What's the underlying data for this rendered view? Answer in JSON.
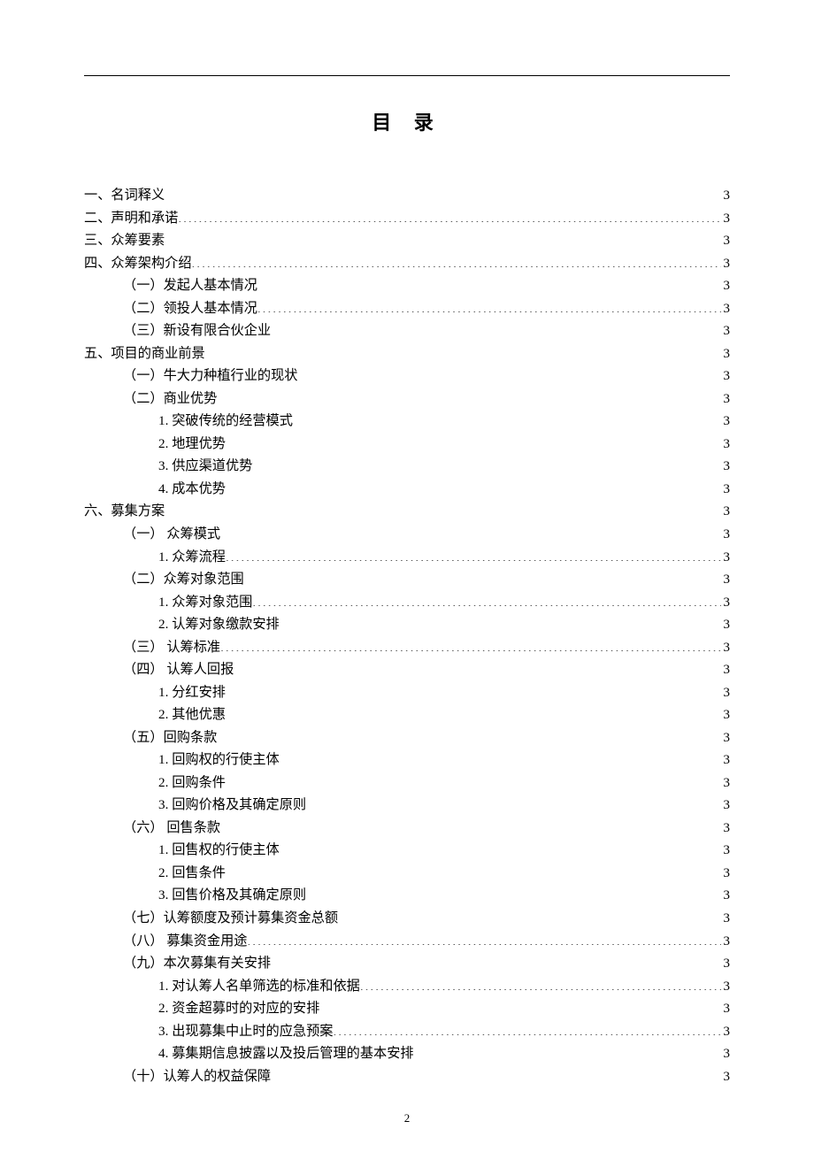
{
  "title": "目 录",
  "page_number": "2",
  "toc": [
    {
      "level": 1,
      "text": "一、名词释义",
      "page": "3"
    },
    {
      "level": 1,
      "text": "二、声明和承诺",
      "page": "3"
    },
    {
      "level": 1,
      "text": "三、众筹要素",
      "page": "3"
    },
    {
      "level": 1,
      "text": "四、众筹架构介绍",
      "page": "3"
    },
    {
      "level": 2,
      "text": "（一）发起人基本情况",
      "page": "3"
    },
    {
      "level": 2,
      "text": "（二）领投人基本情况",
      "page": "3"
    },
    {
      "level": 2,
      "text": "（三）新设有限合伙企业",
      "page": "3"
    },
    {
      "level": 1,
      "text": "五、项目的商业前景",
      "page": "3"
    },
    {
      "level": 2,
      "text": "（一）牛大力种植行业的现状",
      "page": "3"
    },
    {
      "level": 2,
      "text": "（二）商业优势",
      "page": "3"
    },
    {
      "level": 3,
      "text": "1. 突破传统的经营模式",
      "page": "3"
    },
    {
      "level": 3,
      "text": "2. 地理优势",
      "page": "3"
    },
    {
      "level": 3,
      "text": "3. 供应渠道优势",
      "page": "3"
    },
    {
      "level": 3,
      "text": "4. 成本优势",
      "page": "3"
    },
    {
      "level": 1,
      "text": "六、募集方案",
      "page": "3"
    },
    {
      "level": 2,
      "text": "（一） 众筹模式",
      "page": "3"
    },
    {
      "level": 3,
      "text": "1.  众筹流程",
      "page": "3"
    },
    {
      "level": 2,
      "text": "（二）众筹对象范围",
      "page": "3"
    },
    {
      "level": 3,
      "text": "1.  众筹对象范围",
      "page": "3"
    },
    {
      "level": 3,
      "text": "2.  认筹对象缴款安排",
      "page": "3"
    },
    {
      "level": 2,
      "text": "（三） 认筹标准",
      "page": "3"
    },
    {
      "level": 2,
      "text": "（四）   认筹人回报",
      "page": "3"
    },
    {
      "level": 3,
      "text": "1.  分红安排",
      "page": "3"
    },
    {
      "level": 3,
      "text": "2.  其他优惠",
      "page": "3"
    },
    {
      "level": 2,
      "text": "（五）回购条款",
      "page": "3"
    },
    {
      "level": 3,
      "text": "1. 回购权的行使主体",
      "page": "3"
    },
    {
      "level": 3,
      "text": "2. 回购条件",
      "page": "3"
    },
    {
      "level": 3,
      "text": "3. 回购价格及其确定原则",
      "page": "3"
    },
    {
      "level": 2,
      "text": "（六） 回售条款",
      "page": "3"
    },
    {
      "level": 3,
      "text": "1. 回售权的行使主体",
      "page": "3"
    },
    {
      "level": 3,
      "text": "2. 回售条件",
      "page": "3"
    },
    {
      "level": 3,
      "text": "3. 回售价格及其确定原则",
      "page": "3"
    },
    {
      "level": 2,
      "text": "（七）认筹额度及预计募集资金总额",
      "page": "3"
    },
    {
      "level": 2,
      "text": "（八） 募集资金用途",
      "page": "3"
    },
    {
      "level": 2,
      "text": "（九）本次募集有关安排",
      "page": "3"
    },
    {
      "level": 3,
      "text": "1.   对认筹人名单筛选的标准和依据",
      "page": "3"
    },
    {
      "level": 3,
      "text": "2.   资金超募时的对应的安排",
      "page": "3"
    },
    {
      "level": 3,
      "text": "3.   出现募集中止时的应急预案",
      "page": "3"
    },
    {
      "level": 3,
      "text": "4.   募集期信息披露以及投后管理的基本安排",
      "page": "3"
    },
    {
      "level": 2,
      "text": "（十）认筹人的权益保障",
      "page": "3"
    }
  ]
}
